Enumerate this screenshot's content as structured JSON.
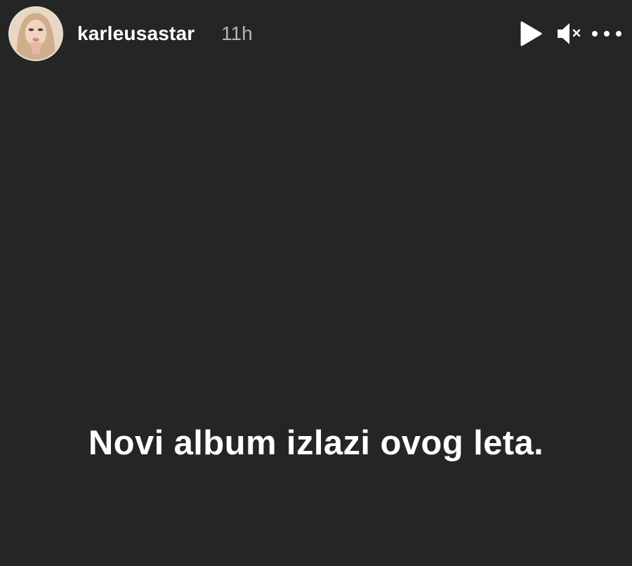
{
  "header": {
    "username": "karleusastar",
    "timestamp": "11h"
  },
  "controls": {
    "play_icon": "play-icon",
    "mute_icon": "speaker-muted-icon",
    "more_icon": "more-horizontal-icon"
  },
  "story": {
    "text": "Novi album izlazi ovog leta."
  },
  "colors": {
    "background": "#252525",
    "text": "#ffffff",
    "timestamp": "#b4b4b4"
  }
}
